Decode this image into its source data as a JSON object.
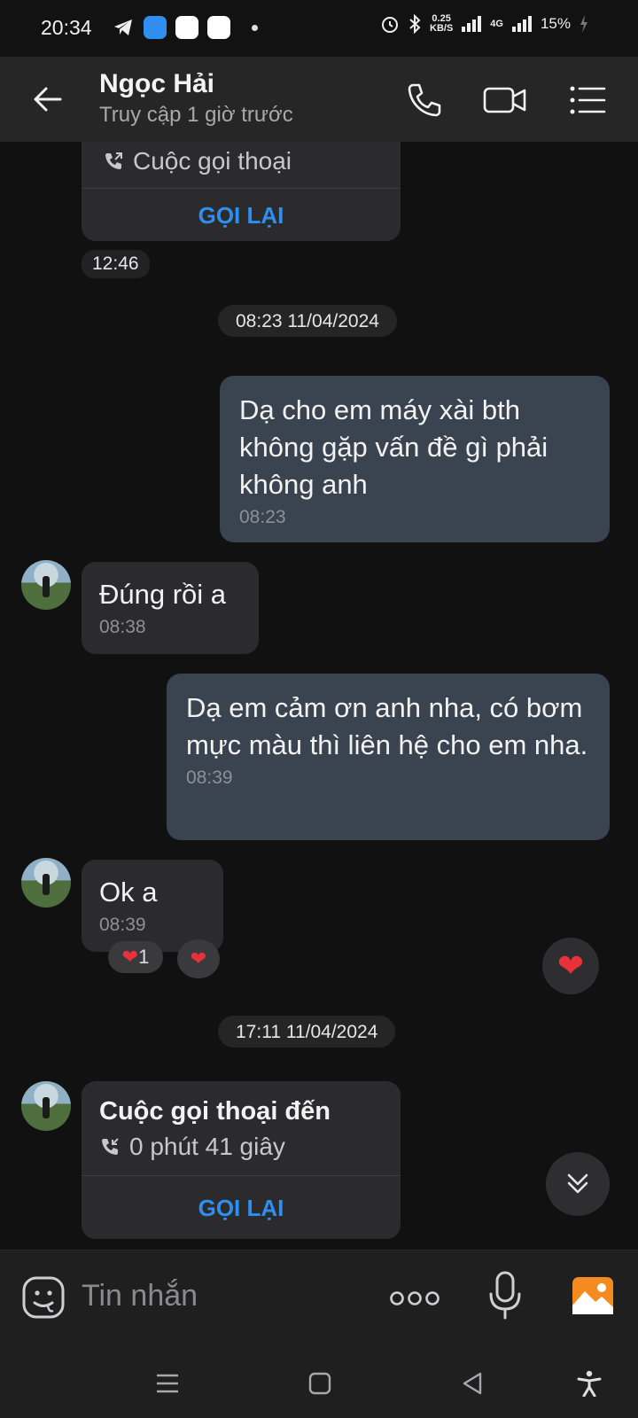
{
  "status_bar": {
    "time": "20:34",
    "net_speed_value": "0.25",
    "net_speed_unit": "KB/S",
    "network": "4G",
    "battery": "15%"
  },
  "header": {
    "contact_name": "Ngọc Hải",
    "last_seen": "Truy cập 1 giờ trước"
  },
  "messages": {
    "top_call": {
      "type_label": "Cuộc gọi thoại",
      "callback_label": "GỌI LẠI",
      "time": "12:46"
    },
    "date_separator_1": "08:23 11/04/2024",
    "out_1": {
      "text": "Dạ cho em máy xài bth không gặp vấn đề gì phải không anh",
      "time": "08:23"
    },
    "in_1": {
      "text": "Đúng rồi a",
      "time": "08:38"
    },
    "out_2": {
      "text": "Dạ em cảm ơn anh nha, có bơm mực màu thì liên hệ cho em nha.",
      "time": "08:39"
    },
    "in_2": {
      "text": "Ok a",
      "time": "08:39",
      "reaction_count": "1"
    },
    "date_separator_2": "17:11 11/04/2024",
    "bottom_call": {
      "title": "Cuộc gọi thoại đến",
      "duration": "0 phút 41 giây",
      "callback_label": "GỌI LẠI"
    }
  },
  "composer": {
    "placeholder": "Tin nhắn"
  },
  "colors": {
    "accent_blue": "#2f8ff0",
    "heart_red": "#e8313b",
    "outgoing_bubble": "#3a4350",
    "incoming_bubble": "#2b2b2d"
  }
}
